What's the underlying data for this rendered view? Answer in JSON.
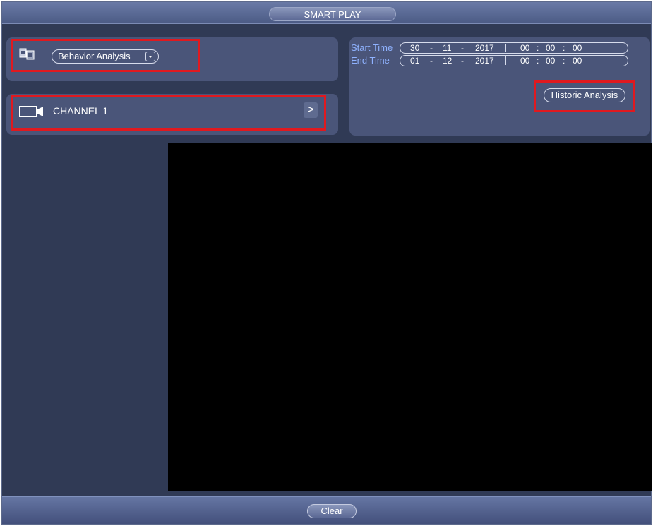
{
  "window": {
    "title": "SMART PLAY"
  },
  "mode": {
    "icon": "behavior-analysis-icon",
    "selected": "Behavior Analysis"
  },
  "channel": {
    "icon": "camera-icon",
    "label": "CHANNEL 1",
    "chevron": ">"
  },
  "time_range": {
    "start_label": "Start Time",
    "end_label": "End Time",
    "start": {
      "day": "30",
      "month": "11",
      "year": "2017",
      "hh": "00",
      "mm": "00",
      "ss": "00"
    },
    "end": {
      "day": "01",
      "month": "12",
      "year": "2017",
      "hh": "00",
      "mm": "00",
      "ss": "00"
    },
    "separator_date": "-",
    "separator_time": ":"
  },
  "actions": {
    "historic_label": "Historic Analysis",
    "clear_label": "Clear"
  },
  "colors": {
    "highlight": "#e0191f",
    "label_blue": "#8fb2ff"
  }
}
